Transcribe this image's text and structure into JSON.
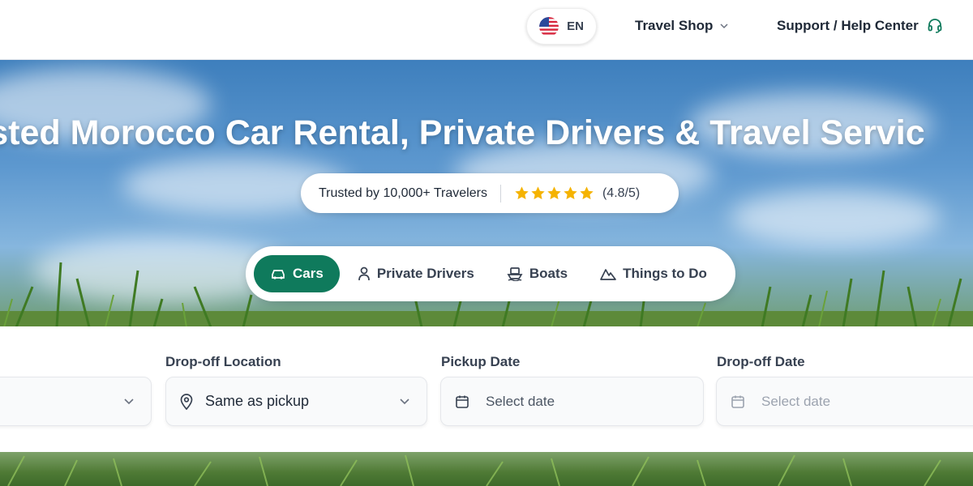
{
  "header": {
    "language": "EN",
    "nav_shop": "Travel Shop",
    "nav_support": "Support / Help Center"
  },
  "hero": {
    "title": "usted Morocco Car Rental, Private Drivers & Travel Servic",
    "trust_text": "Trusted by 10,000+ Travelers",
    "rating_text": "(4.8/5)",
    "rating_value": 4.8,
    "tabs": [
      {
        "label": "Cars",
        "icon": "car-icon",
        "active": true
      },
      {
        "label": "Private Drivers",
        "icon": "person-icon",
        "active": false
      },
      {
        "label": "Boats",
        "icon": "boat-icon",
        "active": false
      },
      {
        "label": "Things to Do",
        "icon": "mountain-icon",
        "active": false
      }
    ]
  },
  "form": {
    "dropoff_label": "Drop-off Location",
    "dropoff_value": "Same as pickup",
    "pickup_date_label": "Pickup Date",
    "pickup_date_placeholder": "Select date",
    "dropoff_date_label": "Drop-off Date",
    "dropoff_date_placeholder": "Select date"
  },
  "colors": {
    "accent": "#0f7a5c",
    "star": "#f5b301",
    "support_icon": "#0f7a5c"
  }
}
